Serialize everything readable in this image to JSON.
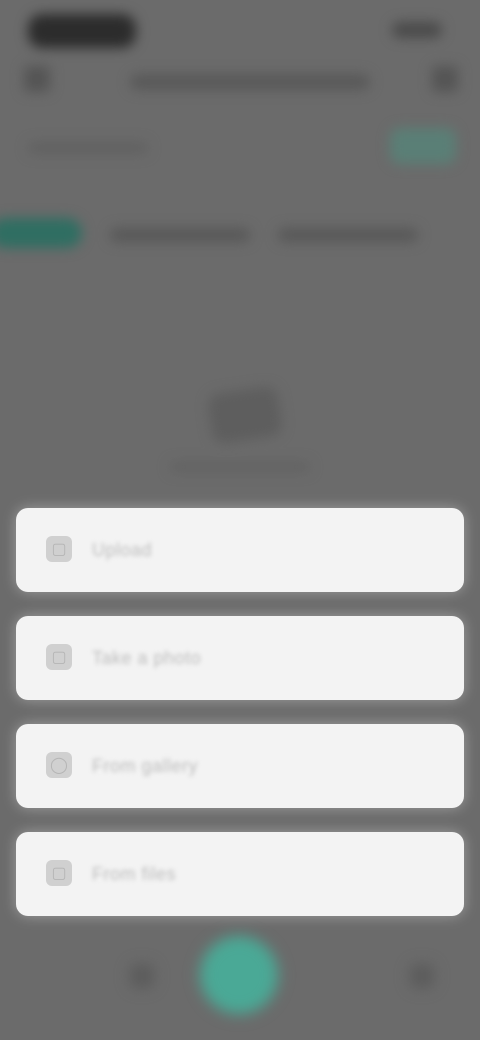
{
  "status_bar": {
    "battery_icon": "battery-icon",
    "signal_icon": "signal-icon"
  },
  "header": {
    "back_icon": "back-arrow-icon",
    "close_icon": "close-icon"
  },
  "tabs": [
    {
      "label": "",
      "active": true
    },
    {
      "label": "",
      "active": false
    },
    {
      "label": "",
      "active": false
    }
  ],
  "colors": {
    "overlay": "#6b6b6b",
    "accent": "#4aa996",
    "sheet_bg": "#f3f3f3"
  },
  "sheet": {
    "options": [
      {
        "icon": "document-icon",
        "label": "Upload"
      },
      {
        "icon": "camera-icon",
        "label": "Take a photo"
      },
      {
        "icon": "image-icon",
        "label": "From gallery"
      },
      {
        "icon": "folder-icon",
        "label": "From files"
      }
    ]
  },
  "bottom_bar": {
    "fab_icon": "add-icon"
  }
}
